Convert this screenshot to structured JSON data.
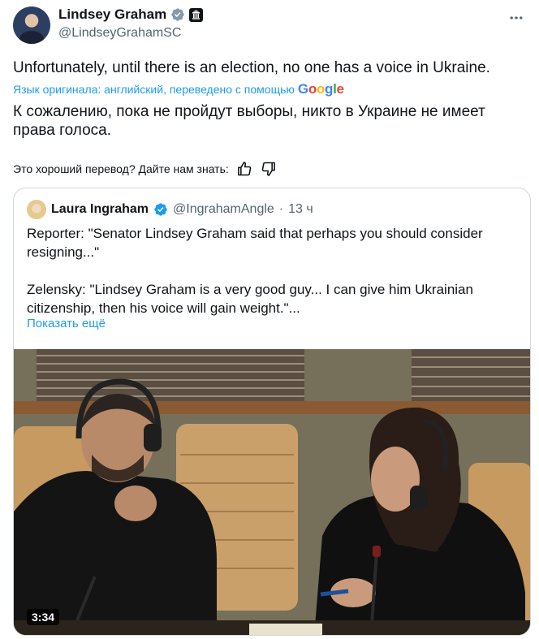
{
  "author": {
    "name": "Lindsey Graham",
    "handle": "@LindseyGrahamSC"
  },
  "tweet": {
    "text": "Unfortunately, until there is an election, no one has a voice in Ukraine.",
    "translation_note": "Язык оригинала: английский, переведено с помощью",
    "translation_provider": "Google",
    "translated_text": "К сожалению, пока не пройдут выборы, никто в Украине не имеет права голоса."
  },
  "feedback": {
    "prompt": "Это хороший перевод? Дайте нам знать:"
  },
  "quote": {
    "name": "Laura Ingraham",
    "handle": "@IngrahamAngle",
    "separator": "·",
    "time": "13 ч",
    "text": "Reporter: \"Senator Lindsey Graham said that perhaps you should consider resigning...\"\n\nZelensky: \"Lindsey Graham is a very good guy... I can give him Ukrainian citizenship, then his voice will gain weight.\"...",
    "show_more": "Показать ещё",
    "video_duration": "3:34"
  },
  "icons": [
    "verified-badge-gray",
    "government-badge",
    "more-icon",
    "thumbs-up-icon",
    "thumbs-down-icon",
    "verified-badge-blue"
  ],
  "colors": {
    "accent": "#1d9bf0",
    "muted": "#536471",
    "border": "#cfd9de",
    "verified_gray": "#829aab"
  }
}
